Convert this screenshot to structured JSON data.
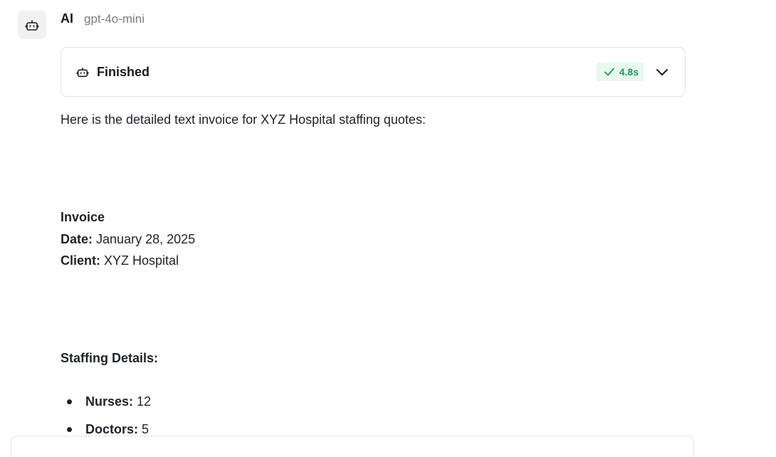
{
  "message": {
    "sender": "AI",
    "model": "gpt-4o-mini",
    "avatar_icon": "robot-icon"
  },
  "status_card": {
    "icon": "robot-icon",
    "label": "Finished",
    "duration": "4.8s",
    "check_icon": "check-icon",
    "toggle_icon": "chevron-down-icon",
    "accent_color": "#1a9a5a",
    "badge_bg": "#e9f8ef"
  },
  "content": {
    "intro": "Here is the detailed text invoice for XYZ Hospital staffing quotes:",
    "invoice_heading": "Invoice",
    "date_label": "Date:",
    "date_value": "January 28, 2025",
    "client_label": "Client:",
    "client_value": "XYZ Hospital",
    "staffing_heading": "Staffing Details:",
    "staffing_items": [
      {
        "label": "Nurses:",
        "value": "12"
      },
      {
        "label": "Doctors:",
        "value": "5"
      }
    ]
  }
}
